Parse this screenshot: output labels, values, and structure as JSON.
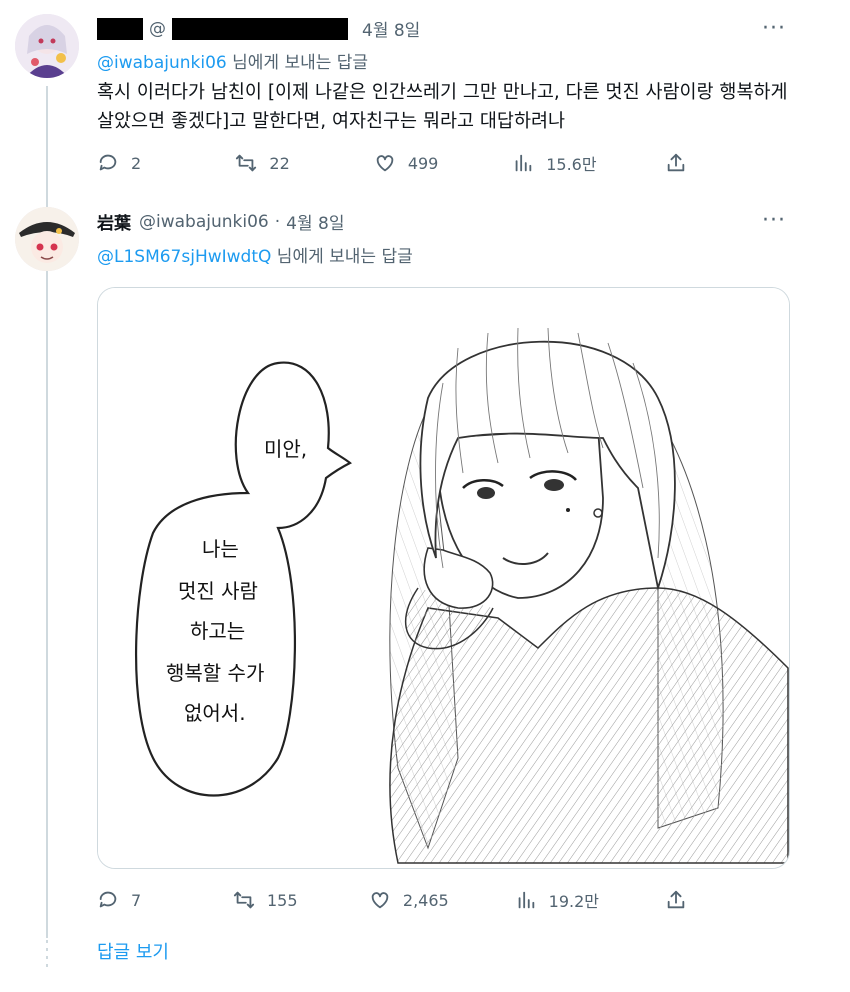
{
  "tweet1": {
    "handle_prefix": "@",
    "time": "4월 8일",
    "more": "···",
    "reply_mention": "@iwabajunki06",
    "reply_suffix": " 님에게 보내는 답글",
    "text_line1": "혹시 이러다가 남친이 [이제 나같은 인간쓰레기 그만 만나고, 다른 멋진 사람이랑 행복하게",
    "text_line2": "살았으면 좋겠다]고 말한다면, 여자친구는 뭐라고 대답하려나",
    "replies": "2",
    "retweets": "22",
    "likes": "499",
    "views": "15.6만"
  },
  "tweet2": {
    "display_name": "岩葉",
    "handle": "@iwabajunki06",
    "dot": "·",
    "time": "4월 8일",
    "more": "···",
    "reply_mention": "@L1SM67sjHwIwdtQ",
    "reply_suffix": " 님에게 보내는 답글",
    "bubble_lines": [
      "미안,",
      "나는",
      "멋진 사람",
      "하고는",
      "행복할 수가",
      "없어서."
    ],
    "replies": "7",
    "retweets": "155",
    "likes": "2,465",
    "views": "19.2만"
  },
  "show_replies": "답글 보기",
  "icons": [
    "reply-icon",
    "retweet-icon",
    "like-icon",
    "views-icon",
    "share-icon",
    "more-icon"
  ],
  "colors": {
    "link": "#1d9bf0",
    "muted": "#536471",
    "text": "#0f1419",
    "border": "#cfd9de"
  }
}
